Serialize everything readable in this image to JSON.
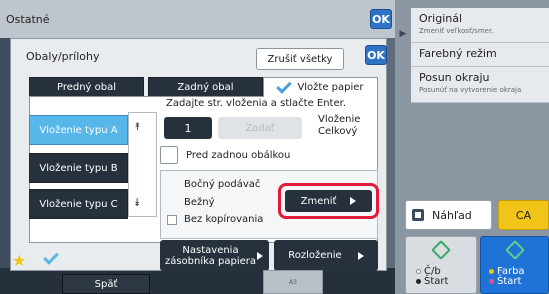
{
  "header": {
    "title": "Ostatné",
    "ok_label": "OK"
  },
  "dialog": {
    "title": "Obaly/prílohy",
    "clear_all_label": "Zrušiť všetky",
    "ok_label": "OK",
    "tabs": [
      {
        "label": "Predný obal"
      },
      {
        "label": "Zadný obal"
      },
      {
        "label": "Vložte papier"
      }
    ],
    "instruction": "Zadajte str. vloženia a stlačte Enter.",
    "insert_types": [
      {
        "label": "Vloženie typu A"
      },
      {
        "label": "Vloženie typu B"
      },
      {
        "label": "Vloženie typu C"
      }
    ],
    "page_number": "1",
    "enter_label": "Zadať",
    "total_label_line1": "Vloženie",
    "total_label_line2": "Celkový",
    "before_back_cover_label": "Pred zadnou obálkou",
    "paper_source": "Bočný podávač",
    "paper_type": "Bežný",
    "no_copy_label": "Bez kopírovania",
    "change_label": "Zmeniť",
    "tray_settings_line1": "Nastavenia",
    "tray_settings_line2": "zásobníka papiera",
    "layout_label": "Rozloženie"
  },
  "right_panel": {
    "items": [
      {
        "title": "Originál",
        "subtitle": "Zmeniť veľkosť/smer."
      },
      {
        "title": "Farebný režim",
        "subtitle": ""
      },
      {
        "title": "Posun okraju",
        "subtitle": "Posunúť na vytvorenie okraja"
      }
    ],
    "preview_label": "Náhľad",
    "ca_label": "CA",
    "bw_start_line1": "Č/b",
    "bw_start_line2": "Štart",
    "color_start_line1": "Farba",
    "color_start_line2": "Štart"
  },
  "bottom": {
    "back_label": "Späť",
    "thumb_label": "A3"
  },
  "colors": {
    "accent_blue": "#2f73c5",
    "selected_tab": "#56b7e8",
    "highlight_red": "#e21c38",
    "ca_yellow": "#f0c419"
  }
}
